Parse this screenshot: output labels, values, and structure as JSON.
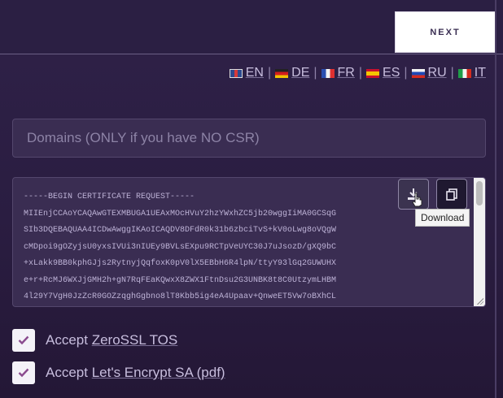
{
  "nav": {
    "next_label": "NEXT"
  },
  "languages": [
    {
      "code": "EN",
      "flag": "flag-en-icon"
    },
    {
      "code": "DE",
      "flag": "flag-de-icon"
    },
    {
      "code": "FR",
      "flag": "flag-fr-icon"
    },
    {
      "code": "ES",
      "flag": "flag-es-icon"
    },
    {
      "code": "RU",
      "flag": "flag-ru-icon"
    },
    {
      "code": "IT",
      "flag": "flag-it-icon"
    }
  ],
  "language_separator": "|",
  "domains": {
    "placeholder": "Domains (ONLY if you have NO CSR)",
    "value": ""
  },
  "csr": {
    "text": "-----BEGIN CERTIFICATE REQUEST-----\nMIIEnjCCAoYCAQAwGTEXMBUGA1UEAxMOcHVuY2hzYWxhZC5jb20wggIiMA0GCSqG\nSIb3DQEBAQUAA4ICDwAwggIKAoICAQDV8DFdR0k31b6zbciTvS+kV0oLwg8oVQgW\ncMDpoi9gOZyjsU0yxsIVUi3nIUEy9BVLsEXpu9RCTpVeUYC30J7uJsozD/gXQ9bC\n+xLakk9BB0kphGJjs2RytnyjQqfoxK0pV0lX5EBbH6R4lpN/ttyY93lGq2GUWUHX\ne+r+RcMJ6WXJjGMH2h+gN7RqFEaKQwxX8ZWX1FtnDsu2G3UNBK8t8C0UtzymLHBM\n4l29Y7VgH0JzZcR0GOZzqghGgbno8lT8Kbb5ig4eA4Upaav+QnweET5Vw7oBXhCL"
  },
  "actions": {
    "download_icon": "download-icon",
    "copy_icon": "copy-icon",
    "download_tooltip": "Download"
  },
  "checkboxes": [
    {
      "prefix": "Accept ",
      "link": "ZeroSSL TOS",
      "checked": true
    },
    {
      "prefix": "Accept ",
      "link": "Let's Encrypt SA (pdf)",
      "checked": true
    }
  ],
  "colors": {
    "background": "#2a1d41",
    "check": "#8a4a8e",
    "next_bg": "#ffffff"
  }
}
